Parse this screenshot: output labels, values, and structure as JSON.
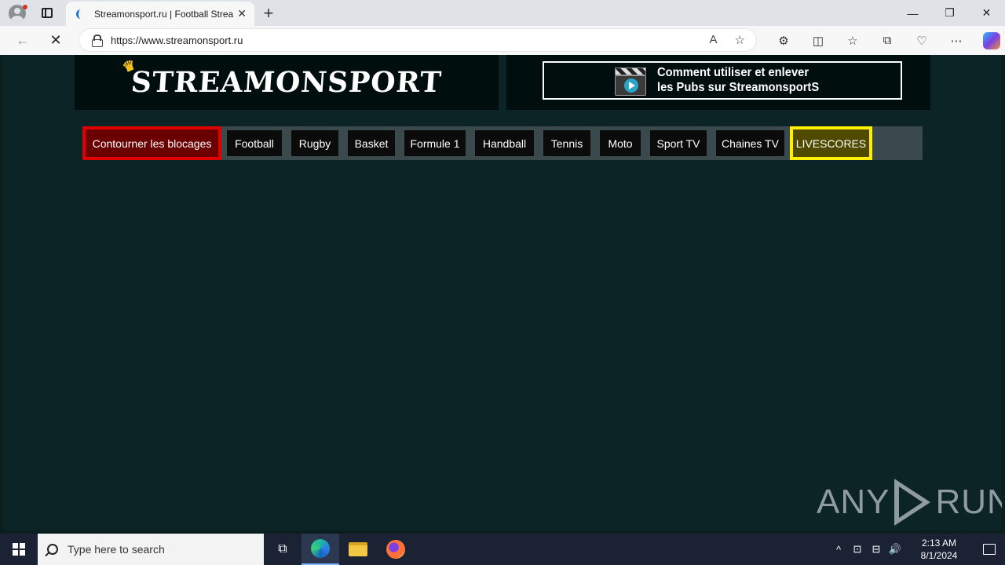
{
  "browser": {
    "tab_title": "Streamonsport.ru | Football Strea",
    "tab_close": "✕",
    "new_tab": "+",
    "url": "https://www.streamonsport.ru",
    "window_controls": [
      "—",
      "❐",
      "✕"
    ],
    "back_glyph": "←",
    "stop_glyph": "✕",
    "read_aloud_glyph": "A",
    "favorite_glyph": "☆",
    "toolbar_glyphs": [
      "⚙",
      "◫",
      "☆",
      "⧉",
      "♡",
      "⋯"
    ]
  },
  "site": {
    "logo_text": "STREAMONSPORT",
    "promo_line1": "Comment utiliser et enlever",
    "promo_line2": "les Pubs sur StreamonsportS",
    "menu": [
      {
        "label": "Contourner les blocages",
        "style": "red"
      },
      {
        "label": "Football",
        "style": "default"
      },
      {
        "label": "Rugby",
        "style": "default"
      },
      {
        "label": "Basket",
        "style": "default"
      },
      {
        "label": "Formule 1",
        "style": "default"
      },
      {
        "label": "Handball",
        "style": "default"
      },
      {
        "label": "Tennis",
        "style": "default"
      },
      {
        "label": "Moto",
        "style": "default"
      },
      {
        "label": "Sport TV",
        "style": "default"
      },
      {
        "label": "Chaines TV",
        "style": "default"
      },
      {
        "label": "LIVESCORES",
        "style": "yellow"
      }
    ],
    "watermark_left": "ANY",
    "watermark_right": "RUN"
  },
  "taskbar": {
    "search_placeholder": "Type here to search",
    "task_view_glyph": "⧉",
    "time": "2:13 AM",
    "date": "8/1/2024",
    "tray_glyphs": [
      "^",
      "⊡",
      "⊟",
      "🔊"
    ]
  },
  "colors": {
    "page_bg": "#0c2426",
    "menu_bg": "#3a4a4c",
    "highlight_red": "#e00000",
    "highlight_yellow": "#ffef00"
  }
}
